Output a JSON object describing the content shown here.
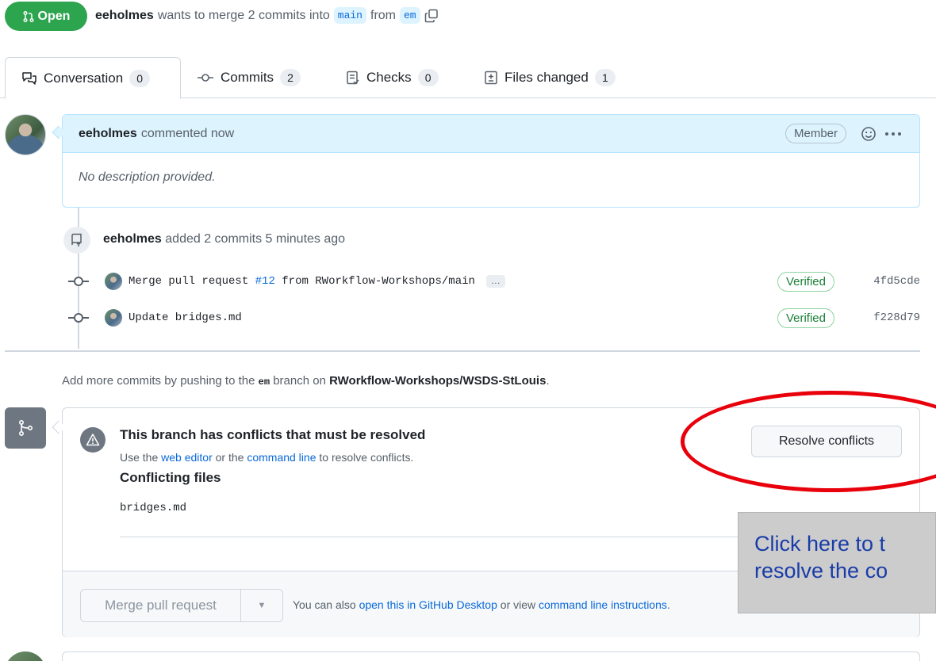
{
  "header": {
    "status": "Open",
    "author": "eeholmes",
    "text_before": "wants to merge 2 commits into",
    "base_branch": "main",
    "text_from": "from",
    "head_branch": "em"
  },
  "tabs": [
    {
      "label": "Conversation",
      "count": "0",
      "icon": "comment-discussion-icon"
    },
    {
      "label": "Commits",
      "count": "2",
      "icon": "commit-icon"
    },
    {
      "label": "Checks",
      "count": "0",
      "icon": "checklist-icon"
    },
    {
      "label": "Files changed",
      "count": "1",
      "icon": "file-diff-icon"
    }
  ],
  "comment": {
    "author": "eeholmes",
    "action": "commented now",
    "role_badge": "Member",
    "body": "No description provided."
  },
  "timeline": {
    "push_author": "eeholmes",
    "push_text": "added 2 commits 5 minutes ago",
    "commits": [
      {
        "message_prefix": "Merge pull request",
        "pr_link": "#12",
        "message_suffix": "from RWorkflow-Workshops/main",
        "badge": "Verified",
        "sha": "4fd5cde",
        "ellipsis": "…"
      },
      {
        "message_prefix": "Update bridges.md",
        "pr_link": "",
        "message_suffix": "",
        "badge": "Verified",
        "sha": "f228d79",
        "ellipsis": ""
      }
    ]
  },
  "push_help": {
    "prefix": "Add more commits by pushing to the",
    "branch": "em",
    "middle": "branch on",
    "repo": "RWorkflow-Workshops/WSDS-StLouis",
    "suffix": "."
  },
  "merge_box": {
    "conflict_title": "This branch has conflicts that must be resolved",
    "desc_prefix": "Use the",
    "web_editor_link": "web editor",
    "desc_middle": "or the",
    "command_line_link": "command line",
    "desc_suffix": "to resolve conflicts.",
    "conflicting_files_title": "Conflicting files",
    "files": [
      "bridges.md"
    ],
    "resolve_button": "Resolve conflicts",
    "merge_button": "Merge pull request",
    "footer_prefix": "You can also",
    "desktop_link": "open this in GitHub Desktop",
    "footer_middle": "or view",
    "instructions_link": "command line instructions",
    "footer_suffix": "."
  },
  "annotation": {
    "line1": "Click here to t",
    "line2": "resolve the co"
  },
  "colors": {
    "open_green": "#2da44e",
    "link_blue": "#0969da",
    "annotation_red": "#e8000b",
    "callout_text": "#1a3ca8"
  }
}
